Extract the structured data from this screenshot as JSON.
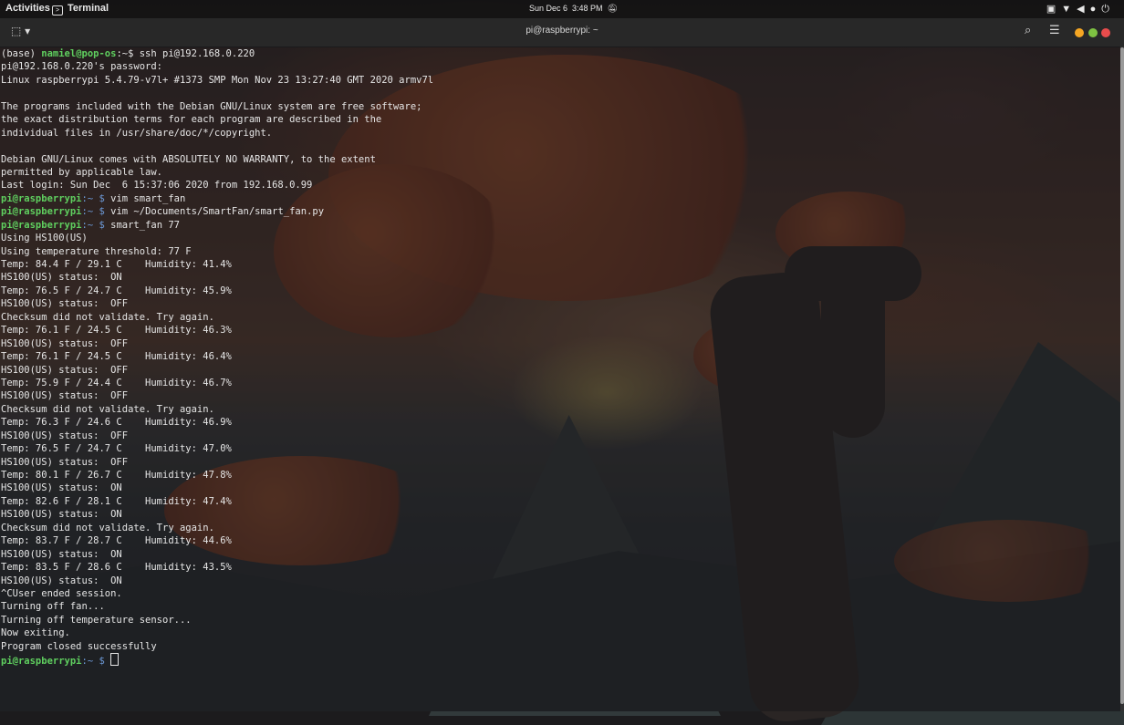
{
  "topbar": {
    "activities": "Activities",
    "app_icon": "terminal-icon",
    "app_name": "Terminal",
    "date": "Sun Dec 6",
    "time": "3:48 PM",
    "dnd_icon": "bell-off-icon",
    "tray_icons": [
      "display-icon",
      "wifi-icon",
      "volume-icon",
      "microphone-icon",
      "power-icon"
    ]
  },
  "window": {
    "title": "pi@raspberrypi: ~",
    "new_tab_icon": "new-tab-icon",
    "search_icon": "search-icon",
    "menu_icon": "hamburger-menu-icon",
    "button_colors": {
      "minimize": "#f5a623",
      "maximize": "#7ec242",
      "close": "#e94c4c"
    }
  },
  "terminal": {
    "lines": [
      {
        "text": "(base) namiel@pop-os:~$ ssh pi@192.168.0.220"
      },
      {
        "text": "pi@192.168.0.220's password:"
      },
      {
        "text": "Linux raspberrypi 5.4.79-v7l+ #1373 SMP Mon Nov 23 13:27:40 GMT 2020 armv7l"
      },
      {
        "text": ""
      },
      {
        "text": "The programs included with the Debian GNU/Linux system are free software;"
      },
      {
        "text": "the exact distribution terms for each program are described in the"
      },
      {
        "text": "individual files in /usr/share/doc/*/copyright."
      },
      {
        "text": ""
      },
      {
        "text": "Debian GNU/Linux comes with ABSOLUTELY NO WARRANTY, to the extent"
      },
      {
        "text": "permitted by applicable law."
      },
      {
        "text": "Last login: Sun Dec  6 15:37:06 2020 from 192.168.0.99"
      },
      {
        "prompt": "pi@raspberrypi",
        "path": ":~ $",
        "cmd": " vim smart_fan"
      },
      {
        "prompt": "pi@raspberrypi",
        "path": ":~ $",
        "cmd": " vim ~/Documents/SmartFan/smart_fan.py"
      },
      {
        "prompt": "pi@raspberrypi",
        "path": ":~ $",
        "cmd": " smart_fan 77"
      },
      {
        "text": "Using HS100(US)"
      },
      {
        "text": "Using temperature threshold: 77 F"
      },
      {
        "text": "Temp: 84.4 F / 29.1 C    Humidity: 41.4%"
      },
      {
        "text": "HS100(US) status:  ON"
      },
      {
        "text": "Temp: 76.5 F / 24.7 C    Humidity: 45.9%"
      },
      {
        "text": "HS100(US) status:  OFF"
      },
      {
        "text": "Checksum did not validate. Try again."
      },
      {
        "text": "Temp: 76.1 F / 24.5 C    Humidity: 46.3%"
      },
      {
        "text": "HS100(US) status:  OFF"
      },
      {
        "text": "Temp: 76.1 F / 24.5 C    Humidity: 46.4%"
      },
      {
        "text": "HS100(US) status:  OFF"
      },
      {
        "text": "Temp: 75.9 F / 24.4 C    Humidity: 46.7%"
      },
      {
        "text": "HS100(US) status:  OFF"
      },
      {
        "text": "Checksum did not validate. Try again."
      },
      {
        "text": "Temp: 76.3 F / 24.6 C    Humidity: 46.9%"
      },
      {
        "text": "HS100(US) status:  OFF"
      },
      {
        "text": "Temp: 76.5 F / 24.7 C    Humidity: 47.0%"
      },
      {
        "text": "HS100(US) status:  OFF"
      },
      {
        "text": "Temp: 80.1 F / 26.7 C    Humidity: 47.8%"
      },
      {
        "text": "HS100(US) status:  ON"
      },
      {
        "text": "Temp: 82.6 F / 28.1 C    Humidity: 47.4%"
      },
      {
        "text": "HS100(US) status:  ON"
      },
      {
        "text": "Checksum did not validate. Try again."
      },
      {
        "text": "Temp: 83.7 F / 28.7 C    Humidity: 44.6%"
      },
      {
        "text": "HS100(US) status:  ON"
      },
      {
        "text": "Temp: 83.5 F / 28.6 C    Humidity: 43.5%"
      },
      {
        "text": "HS100(US) status:  ON"
      },
      {
        "text": "^CUser ended session."
      },
      {
        "text": "Turning off fan..."
      },
      {
        "text": "Turning off temperature sensor..."
      },
      {
        "text": "Now exiting."
      },
      {
        "text": "Program closed successfully"
      },
      {
        "prompt": "pi@raspberrypi",
        "path": ":~ $",
        "cmd": " ",
        "cursor": true
      }
    ],
    "colors": {
      "prompt": "#5fcf5f",
      "path": "#6d9ad8",
      "text": "#e6e6e6"
    }
  }
}
